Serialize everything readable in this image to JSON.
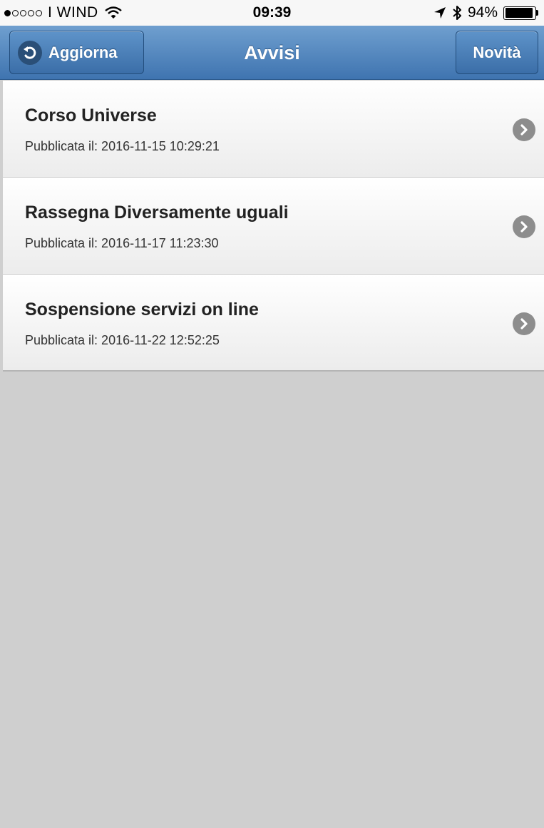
{
  "status_bar": {
    "carrier": "I WIND",
    "time": "09:39",
    "battery_percent": "94%",
    "battery_level": 0.94,
    "signal_strength": 1,
    "signal_max": 5
  },
  "header": {
    "title": "Avvisi",
    "back_button_label": "Aggiorna",
    "new_button_label": "Novità",
    "color": "#4f84bd"
  },
  "notices": [
    {
      "title": "Corso Universe",
      "date": "Pubblicata il: 2016-11-15 10:29:21"
    },
    {
      "title": "Rassegna Diversamente uguali",
      "date": "Pubblicata il: 2016-11-17 11:23:30"
    },
    {
      "title": "Sospensione servizi on line",
      "date": "Pubblicata il: 2016-11-22 12:52:25"
    }
  ],
  "icons": {
    "refresh": "refresh-icon",
    "chevron": "chevron-right-icon",
    "wifi": "wifi-icon",
    "location": "location-arrow-icon",
    "bluetooth": "bluetooth-icon",
    "battery": "battery-icon"
  }
}
